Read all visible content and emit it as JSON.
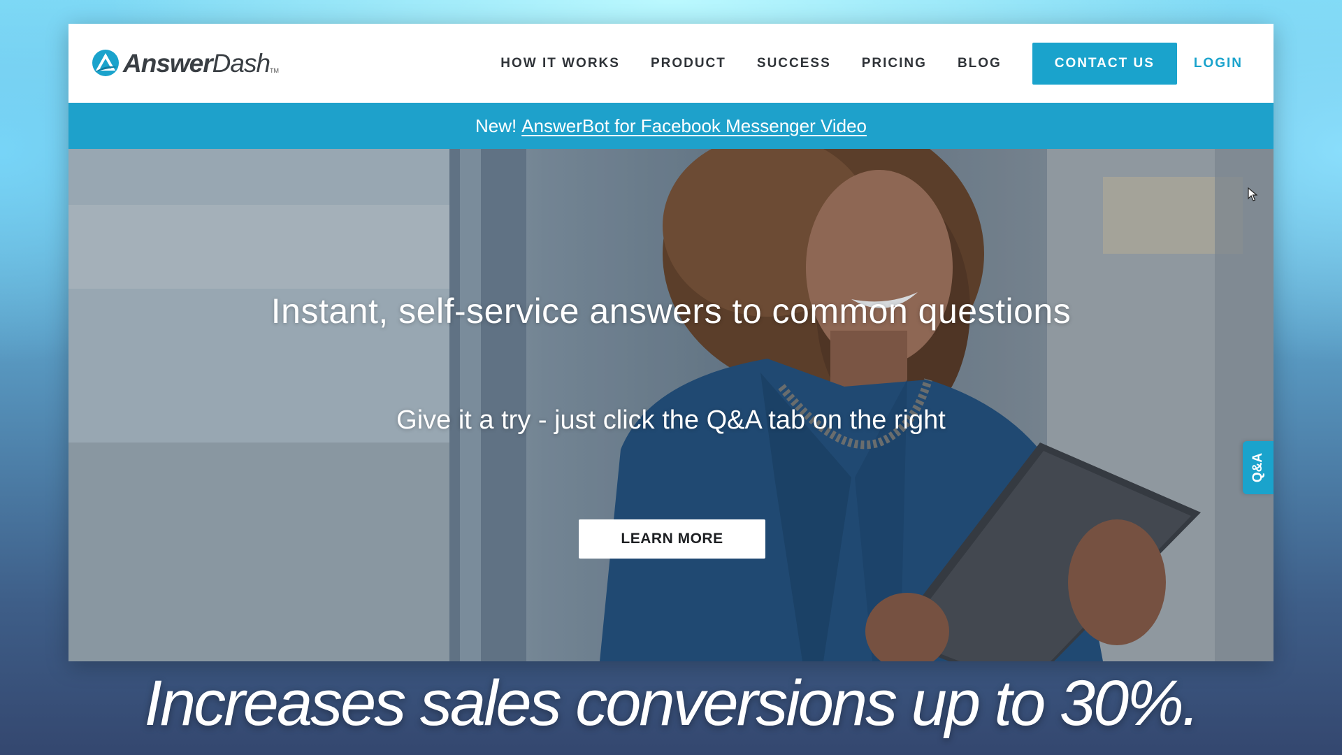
{
  "header": {
    "logo": {
      "bold": "Answer",
      "regular": "Dash",
      "tm": "TM"
    },
    "nav": [
      {
        "label": "HOW IT WORKS"
      },
      {
        "label": "PRODUCT"
      },
      {
        "label": "SUCCESS"
      },
      {
        "label": "PRICING"
      },
      {
        "label": "BLOG"
      }
    ],
    "contact_label": "CONTACT US",
    "login_label": "LOGIN"
  },
  "banner": {
    "prefix": "New!",
    "link": "AnswerBot for Facebook Messenger Video"
  },
  "hero": {
    "title": "Instant, self-service answers to common questions",
    "subtitle": "Give it a try - just click the Q&A tab on the right",
    "button_label": "LEARN MORE",
    "qa_tab_label": "Q&A"
  },
  "caption": "Increases sales conversions up to 30%.",
  "colors": {
    "brand_blue": "#1aa3cc",
    "logo_dark": "#3a3f44",
    "nav_text": "#2f3338",
    "white": "#ffffff"
  },
  "icons": {
    "logo_mark": "answerdash-triangle-icon",
    "cursor": "mouse-pointer-icon"
  }
}
